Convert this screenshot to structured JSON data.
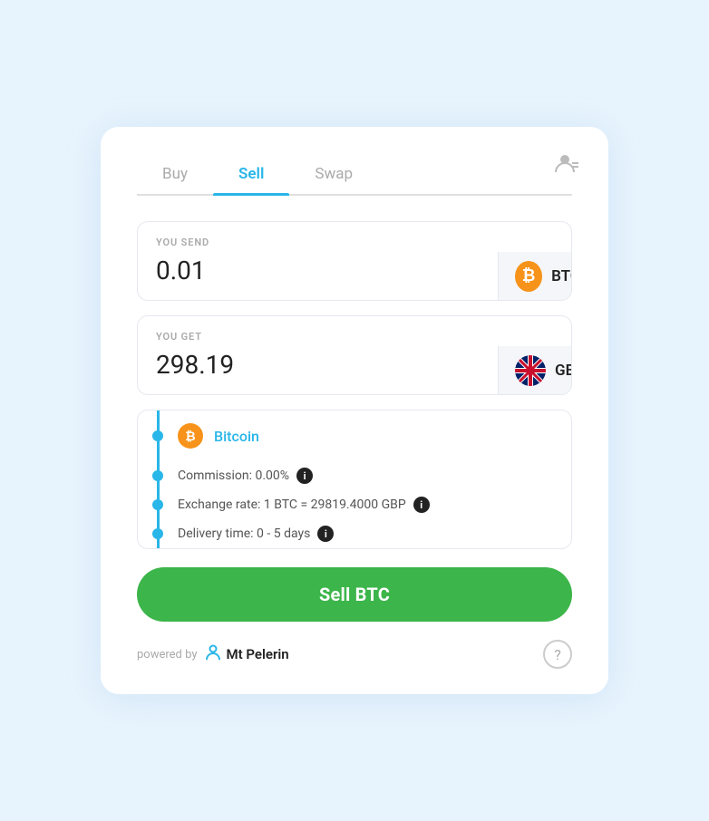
{
  "tabs": [
    {
      "label": "Buy",
      "active": false
    },
    {
      "label": "Sell",
      "active": true
    },
    {
      "label": "Swap",
      "active": false
    }
  ],
  "send": {
    "label": "YOU SEND",
    "value": "0.01",
    "currency_code": "BTC",
    "currency_type": "btc"
  },
  "receive": {
    "label": "YOU GET",
    "value": "298.19",
    "currency_code": "GBP",
    "currency_type": "gbp"
  },
  "dropdown": {
    "selected_label": "Bitcoin"
  },
  "info": {
    "commission": "Commission: 0.00%",
    "exchange_rate": "Exchange rate: 1 BTC = 29819.4000 GBP",
    "delivery": "Delivery time: 0 - 5 days"
  },
  "sell_button": "Sell BTC",
  "footer": {
    "powered_by": "powered by",
    "brand": "Mt\nPelerin"
  }
}
